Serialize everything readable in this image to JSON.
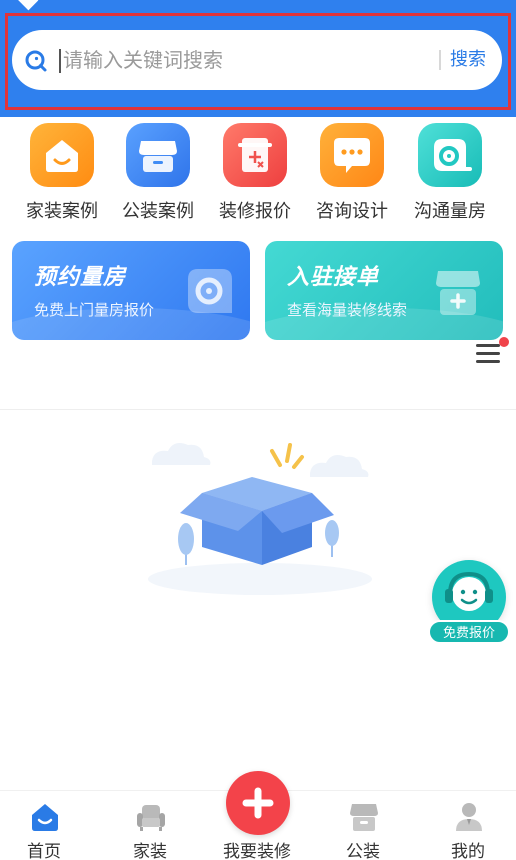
{
  "search": {
    "placeholder": "请输入关键词搜索",
    "button_label": "搜索"
  },
  "categories": [
    {
      "label": "家装案例",
      "icon": "house-icon",
      "color": "#ffa11a"
    },
    {
      "label": "公装案例",
      "icon": "storefront-icon",
      "color": "#3f8cf5"
    },
    {
      "label": "装修报价",
      "icon": "calculator-icon",
      "color": "#f0524d"
    },
    {
      "label": "咨询设计",
      "icon": "chat-icon",
      "color": "#ff9b1f"
    },
    {
      "label": "沟通量房",
      "icon": "tape-measure-icon",
      "color": "#22c8c2"
    }
  ],
  "banners": [
    {
      "title": "预约量房",
      "subtitle": "免费上门量房报价",
      "color": "#3d8cf7"
    },
    {
      "title": "入驻接单",
      "subtitle": "查看海量装修线索",
      "color": "#2bc6c6"
    }
  ],
  "float_button": {
    "label": "免费报价"
  },
  "tabbar": {
    "items": [
      {
        "label": "首页",
        "active": true
      },
      {
        "label": "家装",
        "active": false
      },
      {
        "label": "我要装修",
        "active": false
      },
      {
        "label": "公装",
        "active": false
      },
      {
        "label": "我的",
        "active": false
      }
    ]
  }
}
